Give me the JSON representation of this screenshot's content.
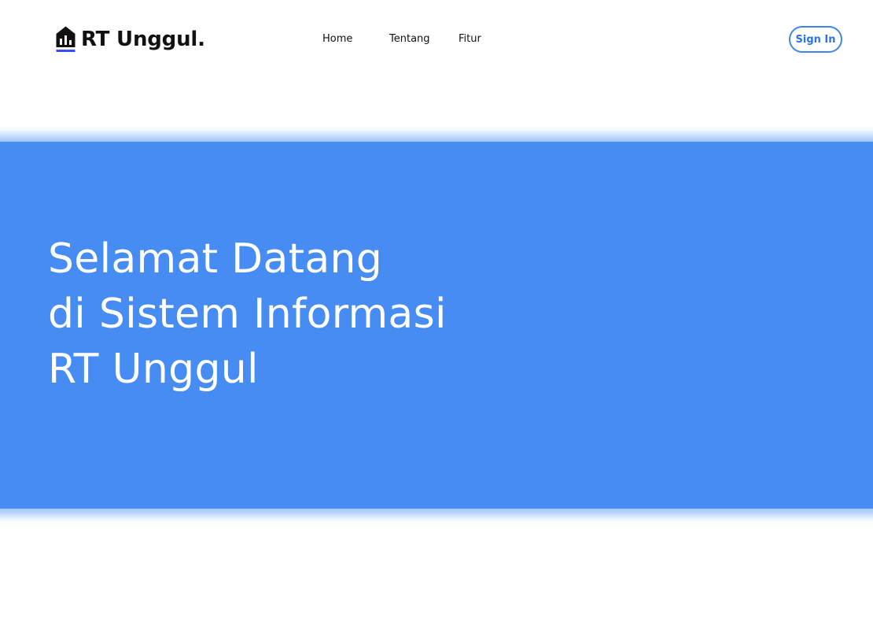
{
  "brand": {
    "name": "RT Unggul.",
    "icon": "house-chart-icon"
  },
  "nav": {
    "items": [
      {
        "label": "Home"
      },
      {
        "label": "Tentang"
      },
      {
        "label": "Fitur"
      }
    ],
    "signin_label": "Sign In"
  },
  "hero": {
    "lines": [
      "Selamat Datang",
      "di Sistem Informasi",
      "RT Unggul"
    ]
  },
  "colors": {
    "accent": "#468cf3",
    "button_border": "#3d85f0",
    "brand_underline": "#3b4cf5",
    "text_dark": "#111111"
  }
}
